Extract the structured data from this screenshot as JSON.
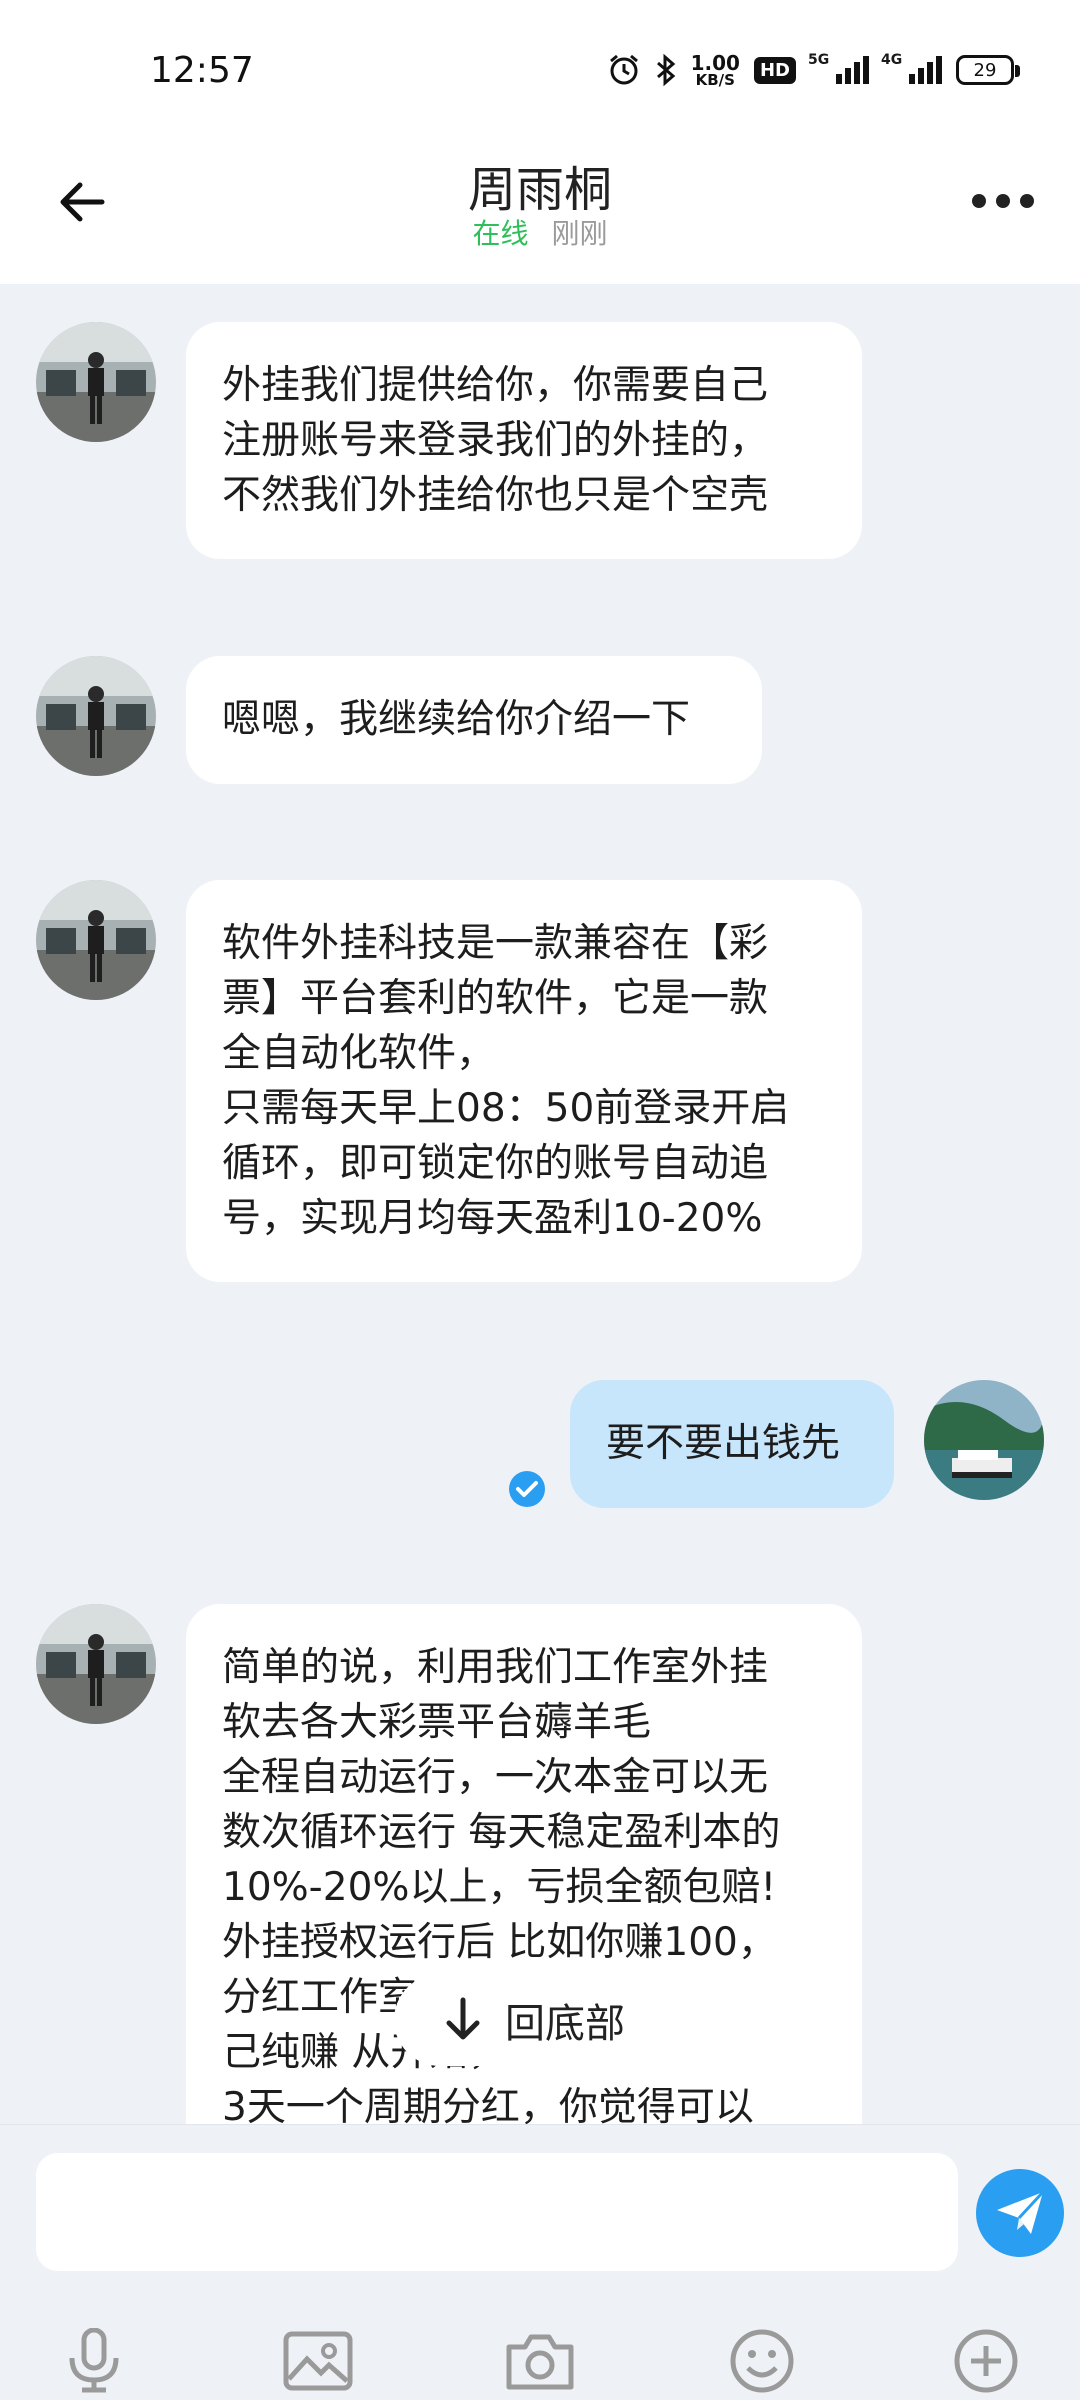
{
  "status_bar": {
    "time": "12:57",
    "net_speed_value": "1.00",
    "net_speed_unit": "KB/S",
    "hd_label": "HD",
    "sig1_label": "5G",
    "sig2_label": "4G",
    "battery": "29"
  },
  "header": {
    "contact_name": "周雨桐",
    "presence_status": "在线",
    "last_seen": "刚刚"
  },
  "messages": [
    {
      "sender": "contact",
      "text": "外挂我们提供给你，你需要自己\n注册账号来登录我们的外挂的，\n不然我们外挂给你也只是个空壳"
    },
    {
      "sender": "contact",
      "text": "嗯嗯，我继续给你介绍一下"
    },
    {
      "sender": "contact",
      "text": "软件外挂科技是一款兼容在【彩\n票】平台套利的软件，它是一款\n全自动化软件，\n只需每天早上08：50前登录开启\n循环，即可锁定你的账号自动追\n号，实现月均每天盈利10-20%"
    },
    {
      "sender": "me",
      "text": "要不要出钱先"
    },
    {
      "sender": "contact",
      "text": "简单的说，利用我们工作室外挂\n软去各大彩票平台薅羊毛\n全程自动运行，一次本金可以无\n数次循环运行 每天稳定盈利本的\n10%-20%以上，亏损全额包赔!\n外挂授权运行后 比如你赚100，\n分红工作室25你自\n己纯赚 从开始，\n3天一个周期分红，你觉得可以"
    }
  ],
  "scroll_to_bottom": {
    "label": "回底部"
  },
  "composer": {
    "placeholder": ""
  },
  "icons": {
    "back": "arrow-left-icon",
    "more": "more-dots-icon",
    "send": "paper-plane-icon",
    "mic": "microphone-icon",
    "image": "image-icon",
    "camera": "camera-icon",
    "emoji": "emoji-icon",
    "plus": "plus-circle-icon"
  },
  "colors": {
    "online": "#2fbf5a",
    "my_bubble": "#c7e5fb",
    "send_button": "#2a9ef0",
    "read_check": "#2a9ef0"
  }
}
